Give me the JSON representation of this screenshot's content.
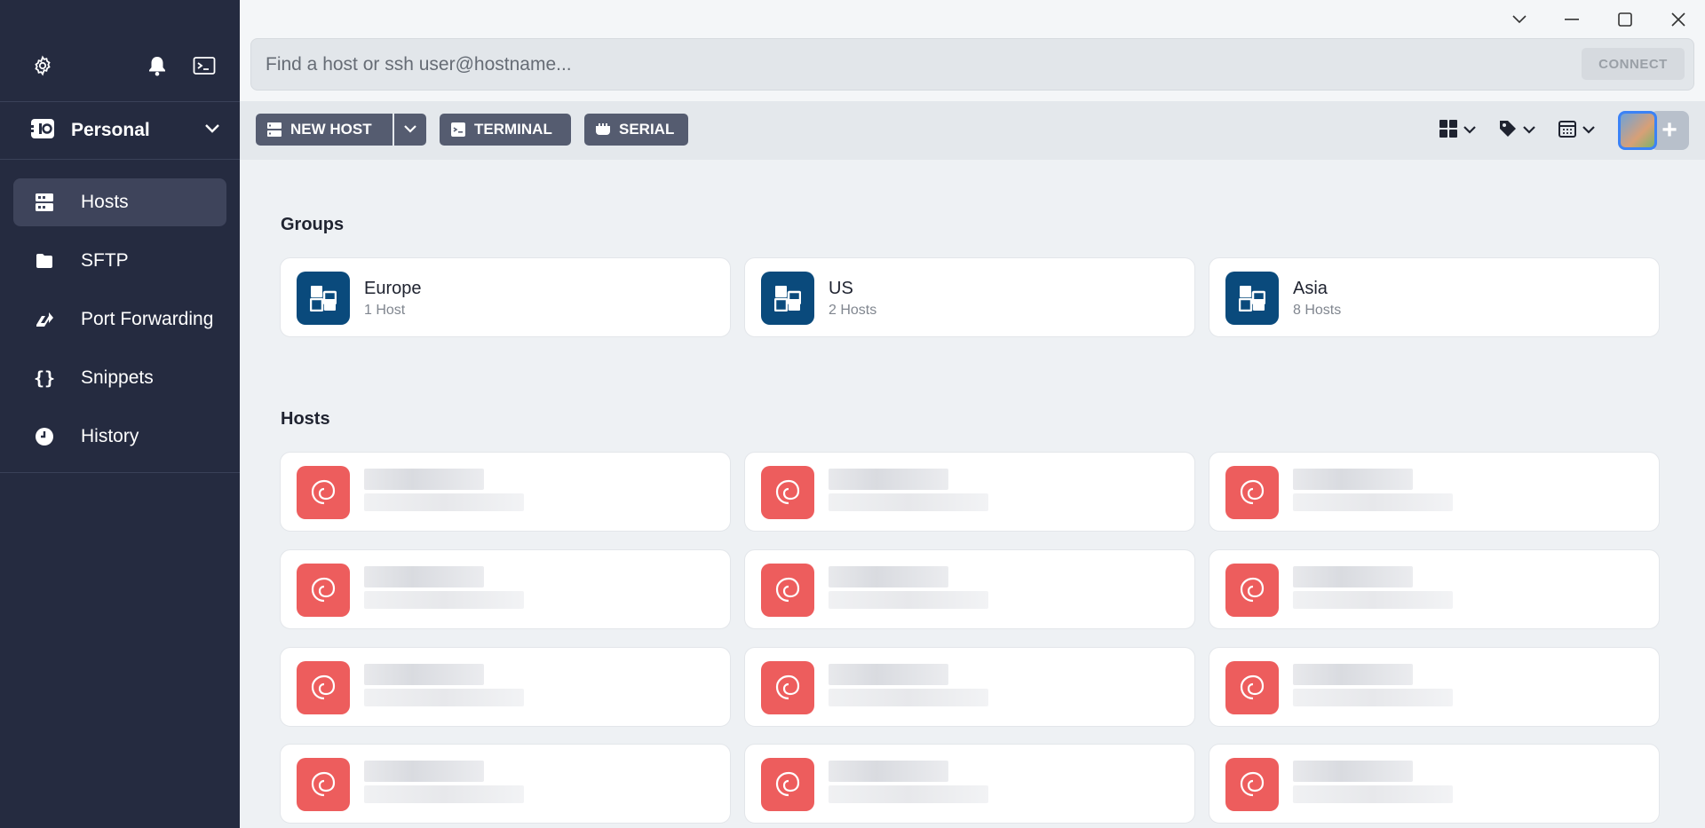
{
  "sidebar": {
    "vault_label": "Personal",
    "items": [
      {
        "label": "Hosts",
        "icon": "hosts-icon"
      },
      {
        "label": "SFTP",
        "icon": "folder-icon"
      },
      {
        "label": "Port Forwarding",
        "icon": "port-forwarding-icon"
      },
      {
        "label": "Snippets",
        "icon": "braces-icon"
      },
      {
        "label": "History",
        "icon": "clock-icon"
      }
    ]
  },
  "search": {
    "placeholder": "Find a host or ssh user@hostname...",
    "connect_label": "CONNECT"
  },
  "toolbar": {
    "new_host_label": "NEW HOST",
    "terminal_label": "TERMINAL",
    "serial_label": "SERIAL"
  },
  "groups": {
    "title": "Groups",
    "items": [
      {
        "name": "Europe",
        "count": "1 Host"
      },
      {
        "name": "US",
        "count": "2 Hosts"
      },
      {
        "name": "Asia",
        "count": "8 Hosts"
      }
    ]
  },
  "hosts": {
    "title": "Hosts"
  },
  "colors": {
    "sidebar_bg": "#252b40",
    "group_icon": "#0a4a7c",
    "host_icon": "#ed5d5d",
    "button_bg": "#555c70"
  }
}
